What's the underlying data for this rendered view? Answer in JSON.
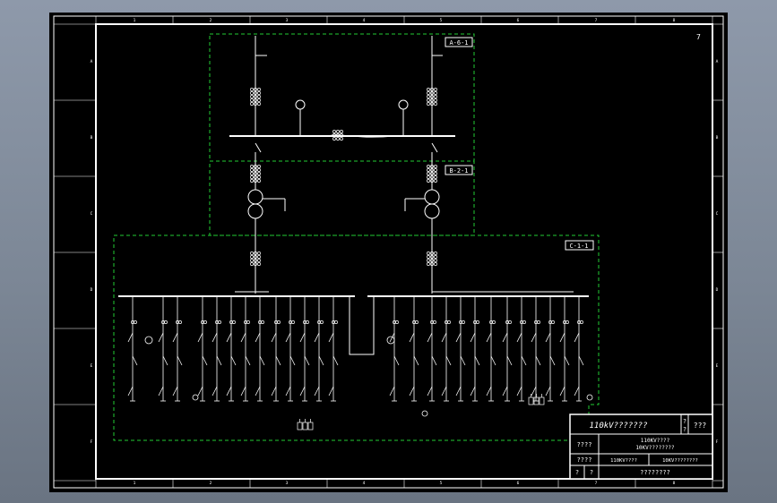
{
  "drawing": {
    "sheet_number": "7",
    "column_markers": [
      "1",
      "2",
      "3",
      "4",
      "5",
      "6",
      "7",
      "8"
    ],
    "row_markers": [
      "A",
      "B",
      "C",
      "D",
      "E",
      "F"
    ],
    "zones": [
      {
        "id": "zone-a",
        "label": "A-6-1"
      },
      {
        "id": "zone-b",
        "label": "B-2-1"
      },
      {
        "id": "zone-c",
        "label": "C-1-1"
      }
    ],
    "title_block": {
      "project_title": "110kV???????",
      "title_mark_top": "?",
      "title_mark_bottom": "?",
      "title_code": "???",
      "row2_label": "????",
      "row2_line1": "110KV????",
      "row2_line2": "10KV????????",
      "row3_label": "????",
      "row3_cell1": "110KV????",
      "row3_cell2": "10KV????????",
      "row4_label1": "?",
      "row4_label2": "?",
      "row4_value": "????????"
    },
    "colors": {
      "background": "#000000",
      "line": "#ffffff",
      "zone_border": "#22cc33"
    }
  }
}
